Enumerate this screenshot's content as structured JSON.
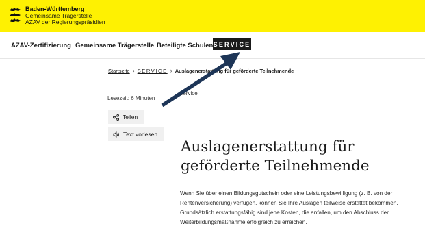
{
  "brand": {
    "line1": "Baden-Württemberg",
    "line2": "Gemeinsame Trägerstelle",
    "line3": "AZAV der Regierungspräsidien",
    "logo_icon": "lions-coat-of-arms-icon"
  },
  "nav": {
    "items": [
      {
        "label": "AZAV-Zertifizierung"
      },
      {
        "label": "Gemeinsame Trägerstelle"
      },
      {
        "label": "Beteiligte Schulen"
      }
    ],
    "active": "SERVICE"
  },
  "breadcrumb": {
    "home": "Startseite",
    "sep": "›",
    "section": "SERVICE",
    "current": "Auslagenerstattung für geförderte Teilnehmende"
  },
  "meta": {
    "lesezeit": "Lesezeit: 6 Minuten",
    "category": "Service"
  },
  "actions": {
    "share": "Teilen",
    "share_icon": "share-icon",
    "read": "Text vorlesen",
    "read_icon": "speaker-icon"
  },
  "article": {
    "title": "Auslagenerstattung für geförderte Teilnehmende",
    "body": "Wenn Sie über einen Bildungsgutschein oder eine Leistungsbewilligung (z. B. von der Rentenversicherung) verfügen, können Sie Ihre Auslagen teilweise erstattet bekommen. Grundsätzlich erstattungsfähig sind jene Kosten, die anfallen, um den Abschluss der Weiterbildungsmaßnahme erfolgreich zu erreichen."
  },
  "colors": {
    "brand_yellow": "#fef102",
    "service_bg": "#1a1a1a",
    "arrow": "#1d3557"
  }
}
